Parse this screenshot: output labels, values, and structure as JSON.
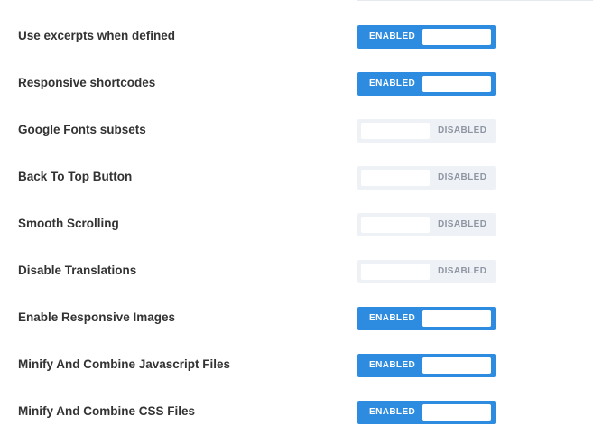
{
  "colors": {
    "enabled_bg": "#2e8ce0",
    "disabled_bg": "#eef1f5",
    "label_text": "#333333",
    "disabled_text": "#8e96a3"
  },
  "settings": [
    {
      "label": "Use excerpts when defined",
      "state": "ENABLED"
    },
    {
      "label": "Responsive shortcodes",
      "state": "ENABLED"
    },
    {
      "label": "Google Fonts subsets",
      "state": "DISABLED"
    },
    {
      "label": "Back To Top Button",
      "state": "DISABLED"
    },
    {
      "label": "Smooth Scrolling",
      "state": "DISABLED"
    },
    {
      "label": "Disable Translations",
      "state": "DISABLED"
    },
    {
      "label": "Enable Responsive Images",
      "state": "ENABLED"
    },
    {
      "label": "Minify And Combine Javascript Files",
      "state": "ENABLED"
    },
    {
      "label": "Minify And Combine CSS Files",
      "state": "ENABLED"
    }
  ]
}
